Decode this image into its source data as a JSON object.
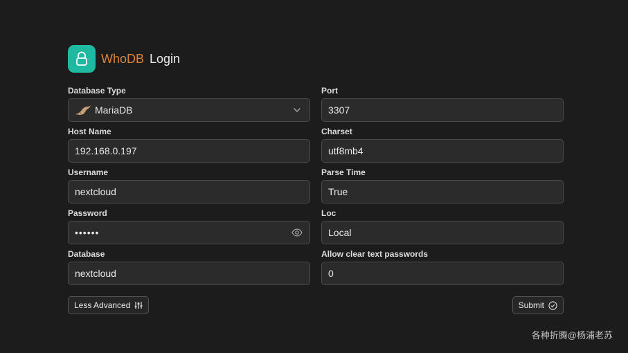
{
  "header": {
    "brand": "WhoDB",
    "title": "Login",
    "icon": "lock-icon",
    "accent_color": "#1fb8a0",
    "brand_color": "#d9843a"
  },
  "form": {
    "database_type": {
      "label": "Database Type",
      "value": "MariaDB",
      "icon": "seal-icon"
    },
    "port": {
      "label": "Port",
      "value": "3307"
    },
    "host_name": {
      "label": "Host Name",
      "value": "192.168.0.197"
    },
    "charset": {
      "label": "Charset",
      "value": "utf8mb4"
    },
    "username": {
      "label": "Username",
      "value": "nextcloud"
    },
    "parse_time": {
      "label": "Parse Time",
      "value": "True"
    },
    "password": {
      "label": "Password",
      "value": "••••••"
    },
    "loc": {
      "label": "Loc",
      "value": "Local"
    },
    "database": {
      "label": "Database",
      "value": "nextcloud"
    },
    "allow_clear_text": {
      "label": "Allow clear text passwords",
      "value": "0"
    }
  },
  "actions": {
    "less_advanced": "Less Advanced",
    "submit": "Submit"
  },
  "watermark": "各种折腾@杨浦老苏"
}
